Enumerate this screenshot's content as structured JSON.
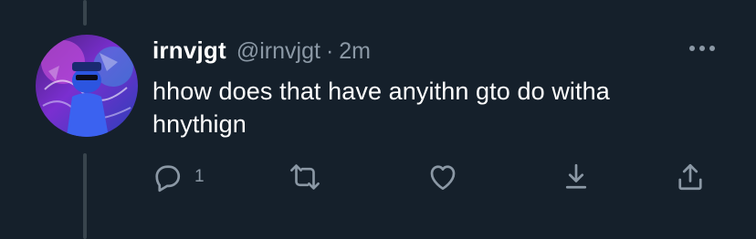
{
  "tweet": {
    "display_name": "irnvjgt",
    "handle": "@irnvjgt",
    "separator": "·",
    "time": "2m",
    "text": "hhow does that have anyithn gto do witha hnythign"
  },
  "actions": {
    "reply_count": "1",
    "icons": [
      "reply-icon",
      "retweet-icon",
      "like-icon",
      "download-icon",
      "share-icon",
      "more-icon"
    ]
  },
  "colors": {
    "background": "#15202b",
    "secondary_text": "#8b98a5",
    "thread_line": "#38444d",
    "primary_text": "#ffffff"
  }
}
